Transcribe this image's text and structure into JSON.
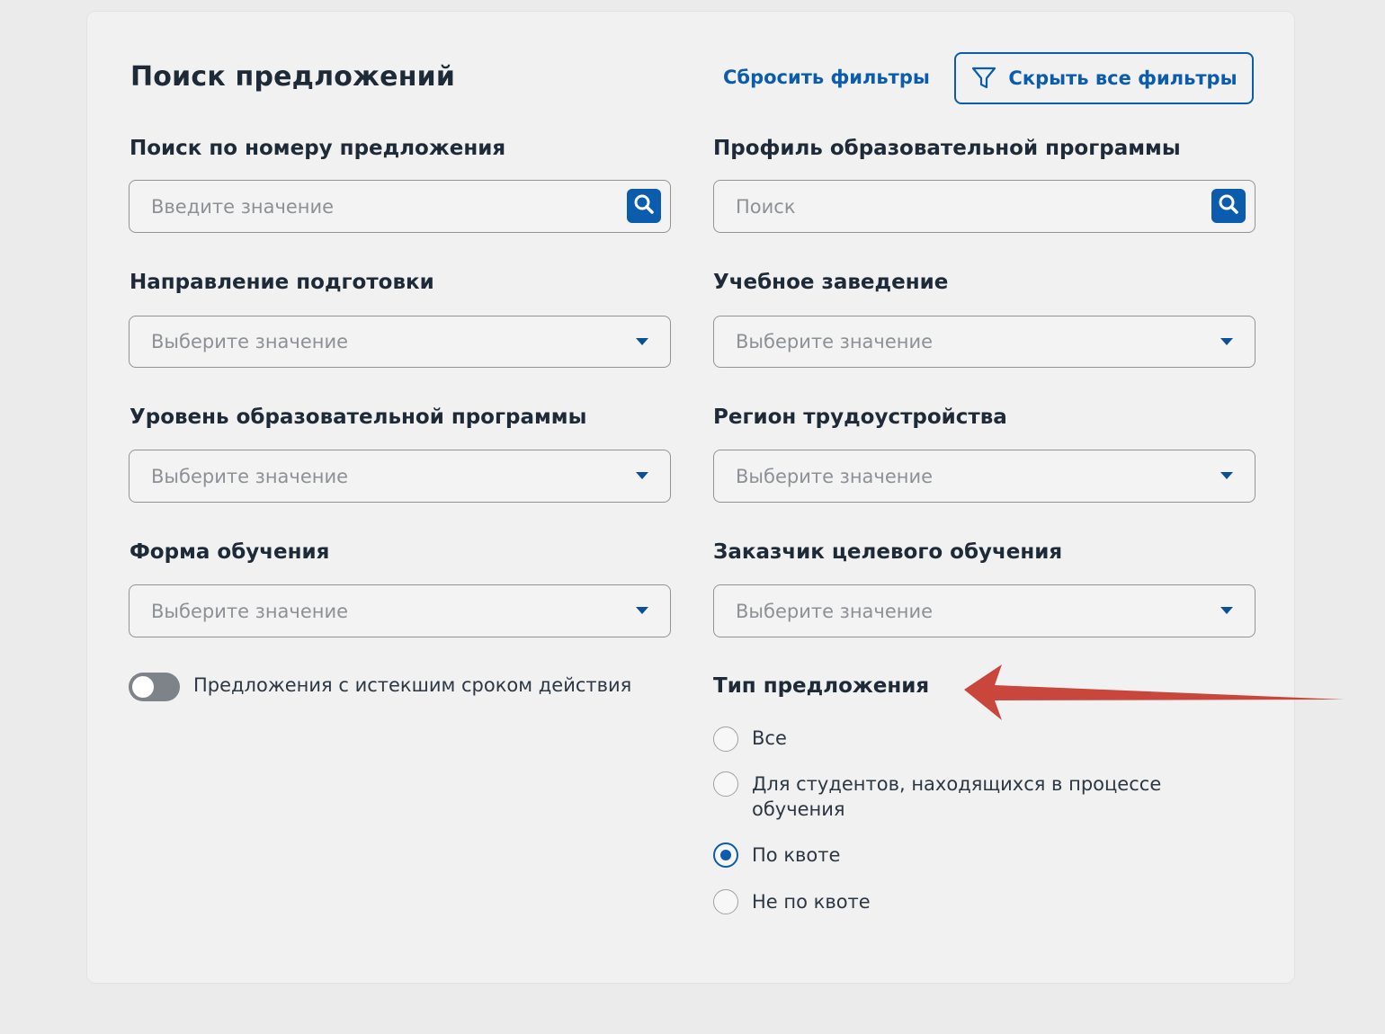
{
  "header": {
    "title": "Поиск предложений",
    "reset_label": "Сбросить фильтры",
    "hide_label": "Скрыть все фильтры"
  },
  "fields": {
    "offer_number": {
      "label": "Поиск по номеру предложения",
      "placeholder": "Введите значение"
    },
    "profile": {
      "label": "Профиль образовательной программы",
      "placeholder": "Поиск"
    },
    "direction": {
      "label": "Направление подготовки",
      "placeholder": "Выберите значение"
    },
    "institution": {
      "label": "Учебное заведение",
      "placeholder": "Выберите значение"
    },
    "level": {
      "label": "Уровень образовательной программы",
      "placeholder": "Выберите значение"
    },
    "region": {
      "label": "Регион трудоустройства",
      "placeholder": "Выберите значение"
    },
    "form": {
      "label": "Форма обучения",
      "placeholder": "Выберите значение"
    },
    "customer": {
      "label": "Заказчик целевого обучения",
      "placeholder": "Выберите значение"
    }
  },
  "expired_toggle": {
    "label": "Предложения с истекшим сроком действия",
    "on": false
  },
  "offer_type": {
    "title": "Тип предложения",
    "options": [
      {
        "label": "Все",
        "checked": false
      },
      {
        "label": "Для студентов, находящихся в процессе обучения",
        "checked": false
      },
      {
        "label": "По квоте",
        "checked": true
      },
      {
        "label": "Не по квоте",
        "checked": false
      }
    ]
  },
  "colors": {
    "accent": "#0b5cad",
    "arrow": "#c9463d",
    "card": "#f1f1f1"
  }
}
